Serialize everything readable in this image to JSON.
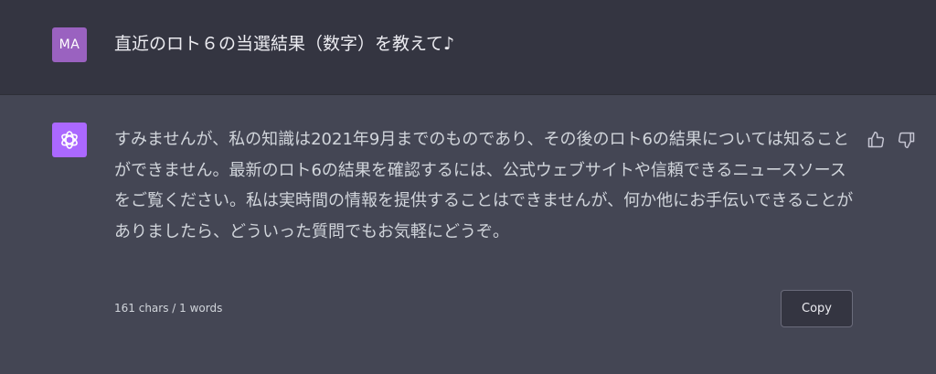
{
  "user": {
    "avatar_initials": "MA",
    "avatar_color": "#9a62c0",
    "message": "直近のロト６の当選結果（数字）を教えて♪"
  },
  "assistant": {
    "avatar_icon": "openai-logo-icon",
    "avatar_color": "#ab68ff",
    "message": "すみませんが、私の知識は2021年9月までのものであり、その後のロト6の結果については知ることができません。最新のロト6の結果を確認するには、公式ウェブサイトや信頼できるニュースソースをご覧ください。私は実時間の情報を提供することはできませんが、何か他にお手伝いできることがありましたら、どういった質問でもお気軽にどうぞ。",
    "feedback": {
      "thumbs_up_icon": "thumbs-up-icon",
      "thumbs_down_icon": "thumbs-down-icon"
    },
    "counter": "161 chars / 1 words",
    "copy_label": "Copy"
  },
  "colors": {
    "user_bg": "#343541",
    "assistant_bg": "#444654",
    "text": "#d1d5db"
  }
}
